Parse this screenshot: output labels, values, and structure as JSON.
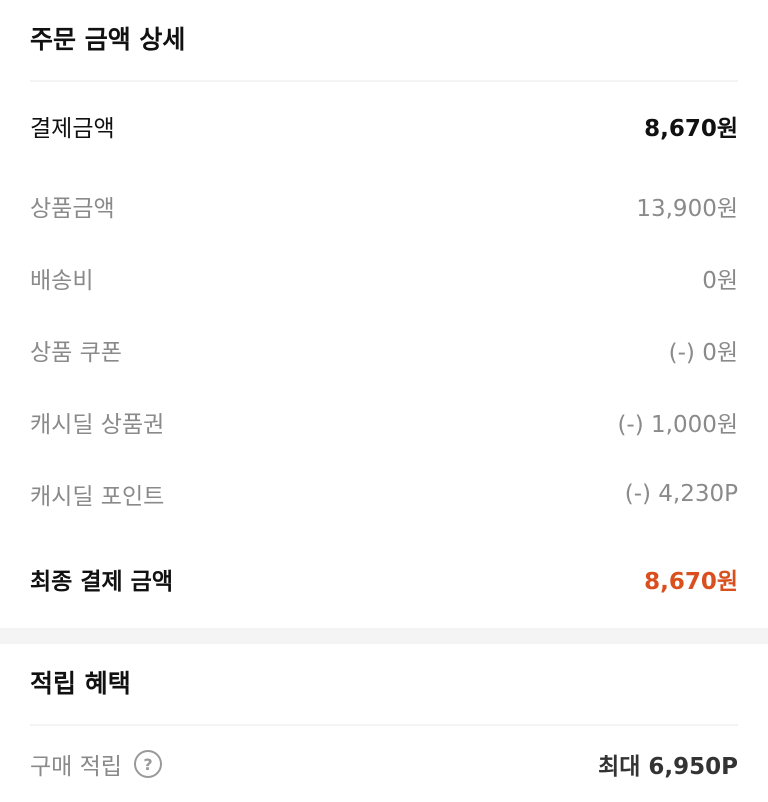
{
  "order": {
    "title": "주문 금액 상세",
    "payment_label": "결제금액",
    "payment_value": "8,670원",
    "lines": [
      {
        "label": "상품금액",
        "value": "13,900원"
      },
      {
        "label": "배송비",
        "value": "0원"
      },
      {
        "label": "상품 쿠폰",
        "value": "(-) 0원"
      },
      {
        "label": "캐시딜 상품권",
        "value": "(-) 1,000원"
      },
      {
        "label": "캐시딜 포인트",
        "value": "(-) 4,230P"
      }
    ],
    "final_label": "최종 결제 금액",
    "final_value": "8,670원"
  },
  "rewards": {
    "title": "적립 혜택",
    "purchase_label": "구매 적립",
    "help_icon": "question-circle-icon",
    "help_glyph": "?",
    "purchase_value": "최대 6,950P"
  },
  "colors": {
    "accent": "#d9501e",
    "muted_text": "#8a8a8a",
    "divider": "#f4f4f4"
  }
}
